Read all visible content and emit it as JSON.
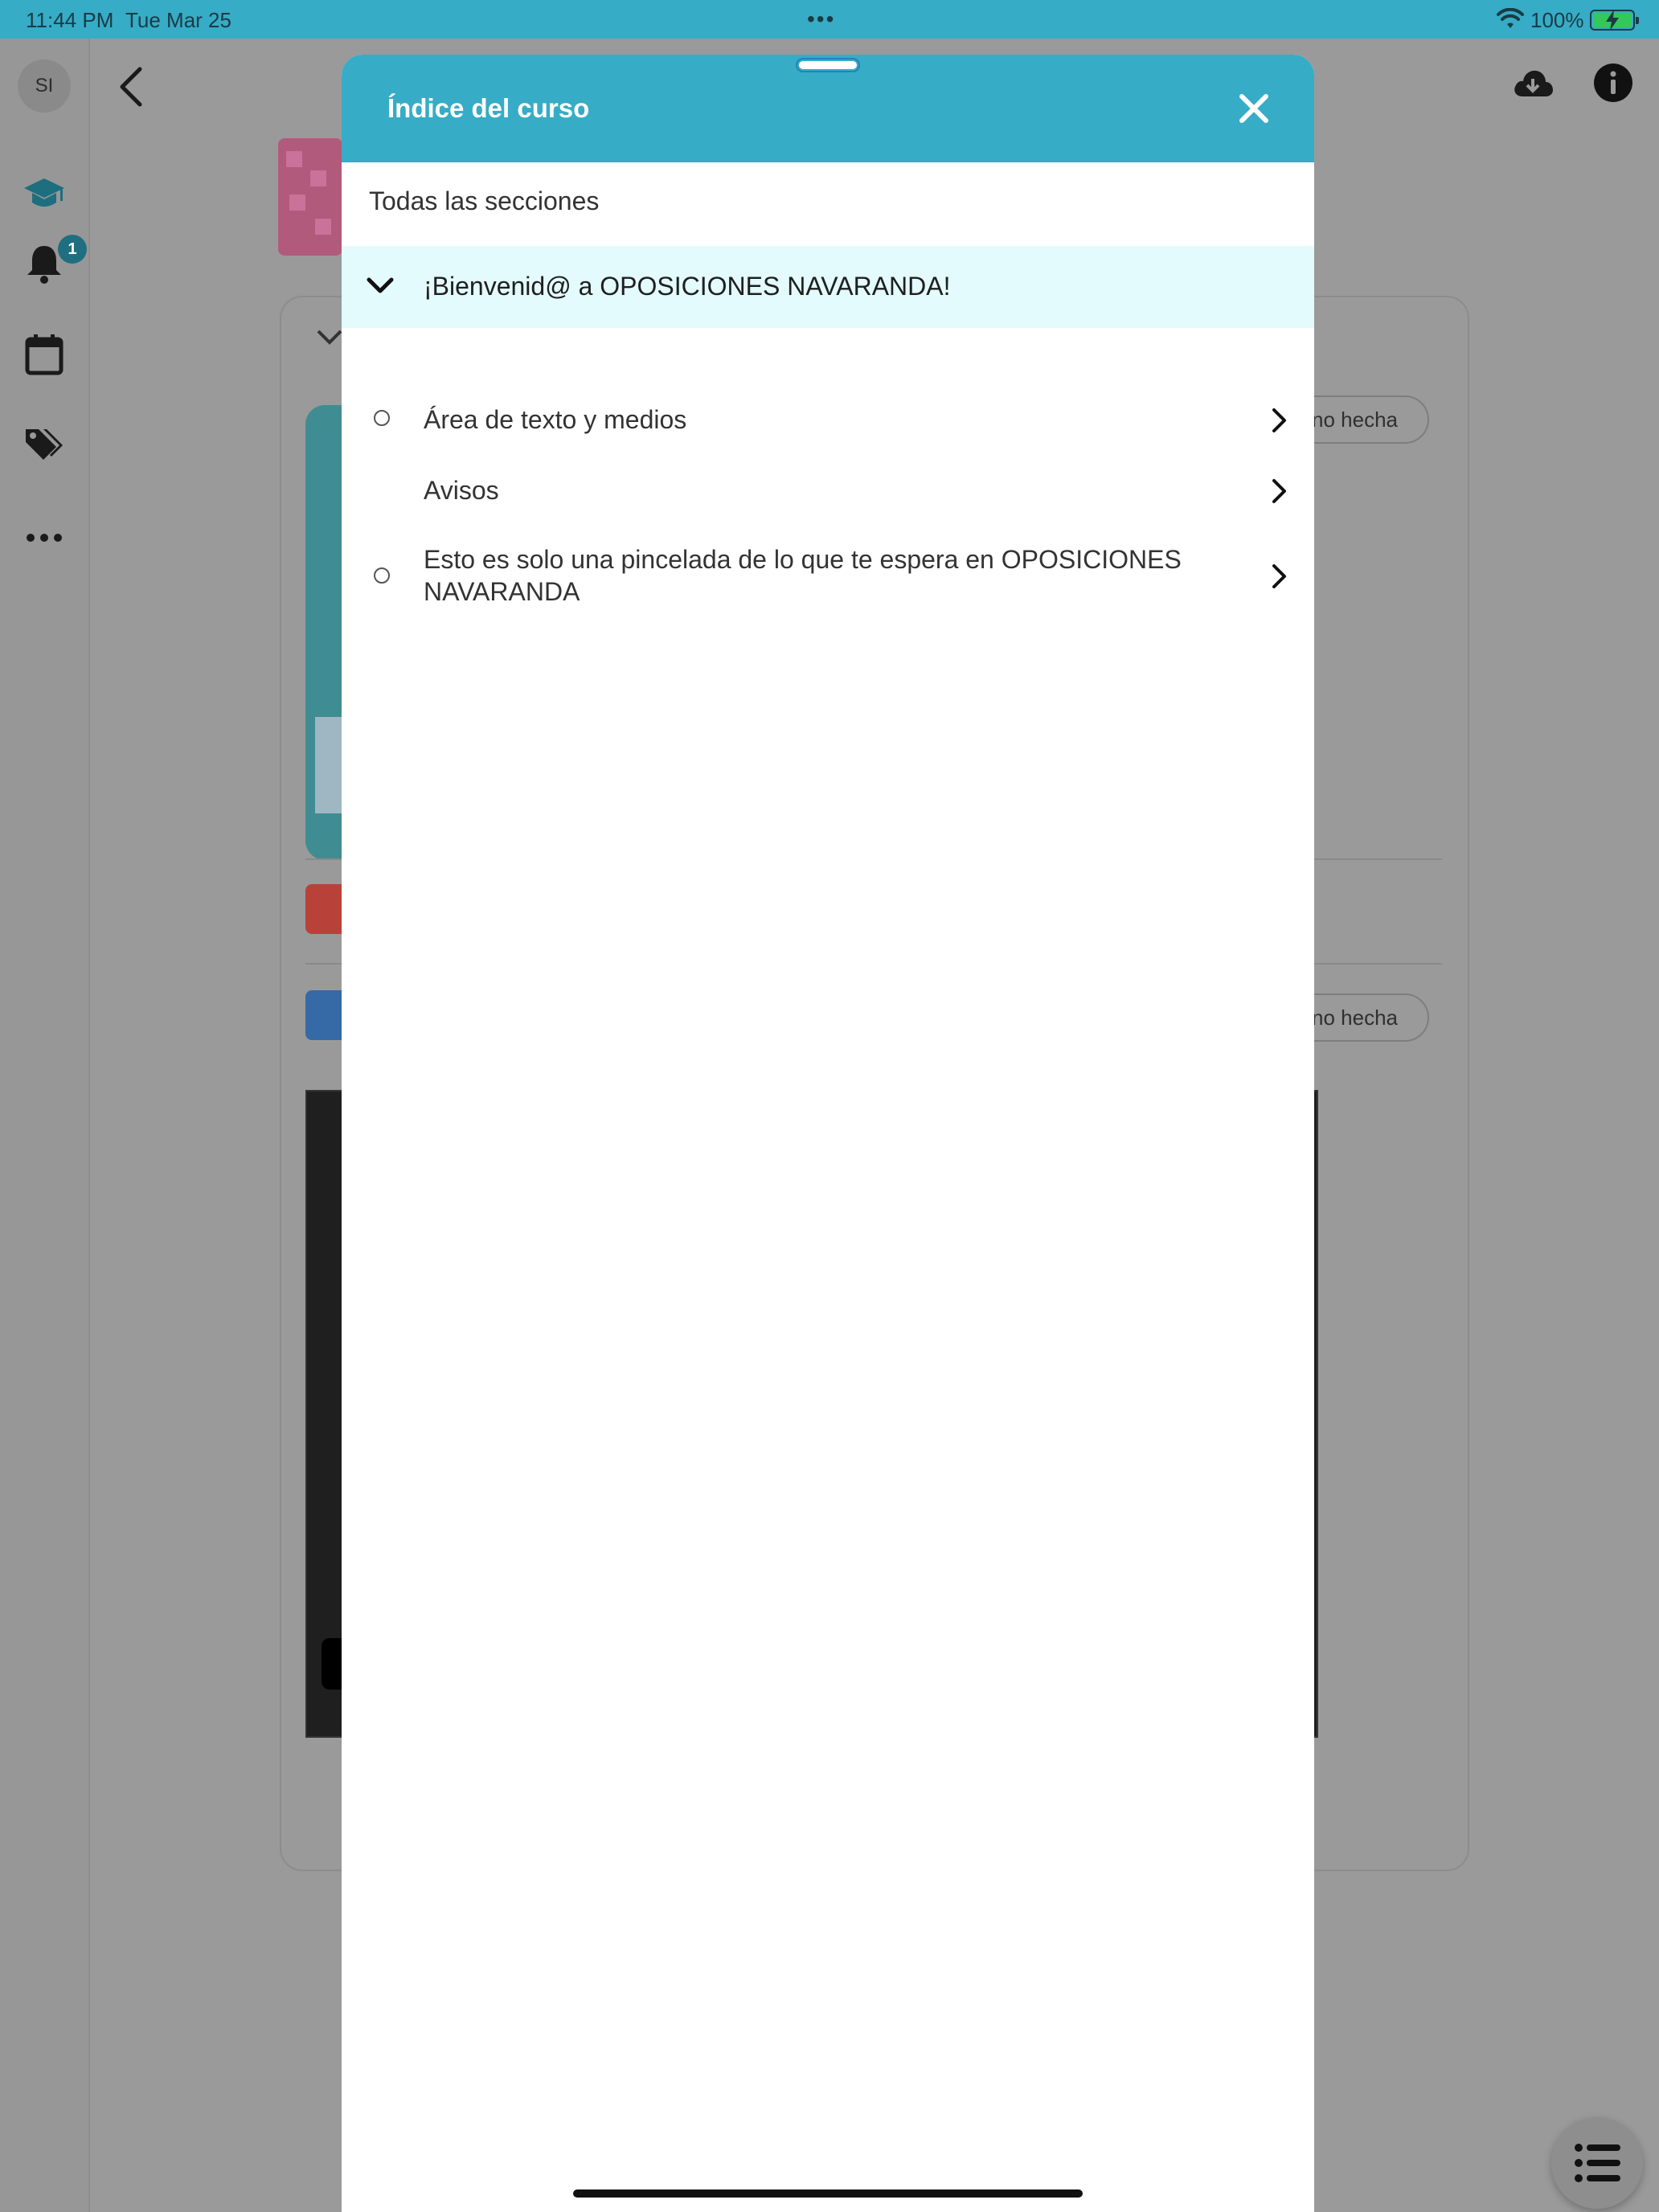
{
  "status_bar": {
    "time": "11:44 PM",
    "date": "Tue Mar 25",
    "battery": "100%",
    "battery_icon": "battery-charging-icon",
    "wifi_icon": "wifi-icon"
  },
  "background": {
    "avatar_initials": "SI",
    "notification_badge": "1",
    "rail_icons": [
      "graduation-cap-icon",
      "bell-icon",
      "calendar-icon",
      "tags-icon",
      "more-horizontal-icon"
    ],
    "mark_done_label_1": "no hecha",
    "mark_done_label_2": "no hecha"
  },
  "sheet": {
    "title": "Índice del curso",
    "all_sections": "Todas las secciones",
    "section": {
      "label": "¡Bienvenid@ a OPOSICIONES NAVARANDA!"
    },
    "items": [
      {
        "label": "Área de texto y medios",
        "has_status": true
      },
      {
        "label": "Avisos",
        "has_status": false
      },
      {
        "label": "Esto es solo una pincelada de lo que te espera en OPOSICIONES NAVARANDA",
        "has_status": true
      }
    ]
  },
  "colors": {
    "header": "#36acc6",
    "section_highlight": "#e3fbfd",
    "overlay": "#9a9a9a"
  }
}
